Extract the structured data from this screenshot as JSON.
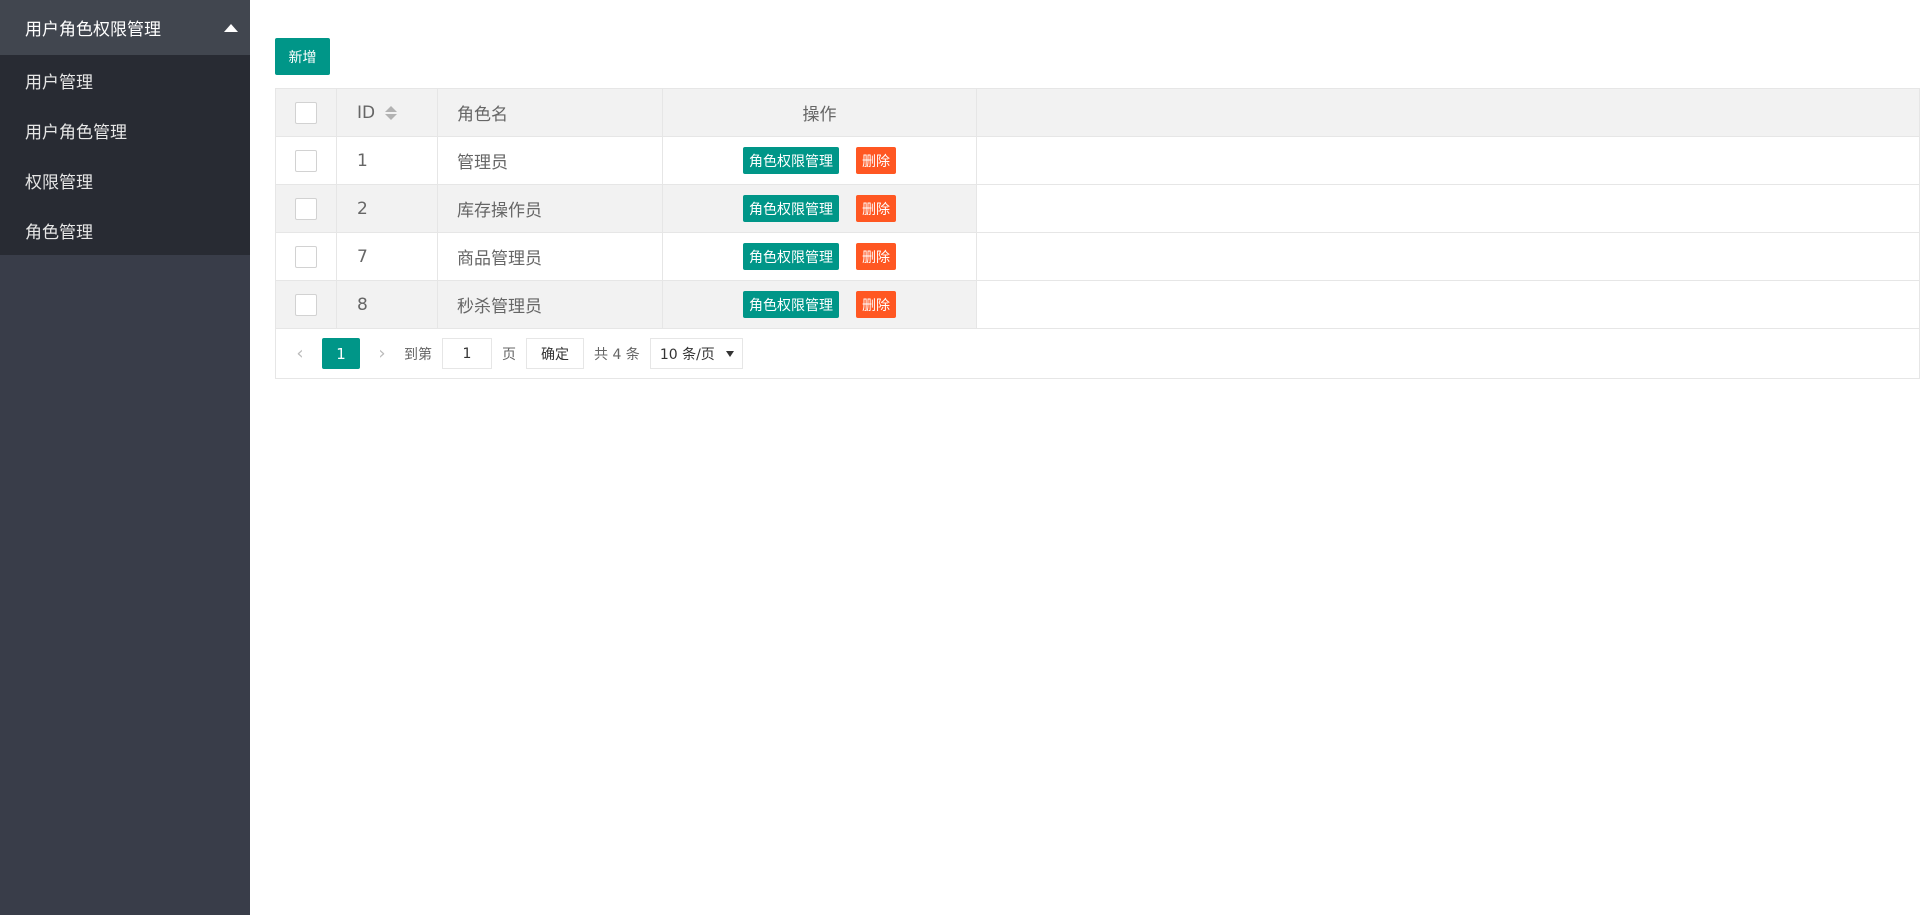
{
  "sidebar": {
    "header": "用户角色权限管理",
    "items": [
      {
        "label": "用户管理"
      },
      {
        "label": "用户角色管理"
      },
      {
        "label": "权限管理"
      },
      {
        "label": "角色管理"
      }
    ]
  },
  "toolbar": {
    "add_label": "新增"
  },
  "table": {
    "headers": {
      "id": "ID",
      "name": "角色名",
      "ops": "操作"
    },
    "rows": [
      {
        "id": "1",
        "name": "管理员"
      },
      {
        "id": "2",
        "name": "库存操作员"
      },
      {
        "id": "7",
        "name": "商品管理员"
      },
      {
        "id": "8",
        "name": "秒杀管理员"
      }
    ],
    "perm_label": "角色权限管理",
    "delete_label": "删除"
  },
  "pager": {
    "current": "1",
    "goto_label": "到第",
    "page_value": "1",
    "page_unit": "页",
    "confirm_label": "确定",
    "total_label": "共 4 条",
    "per_page": "10 条/页"
  },
  "colors": {
    "primary": "#009688",
    "danger": "#ff5722",
    "sidebar": "#393d49"
  }
}
